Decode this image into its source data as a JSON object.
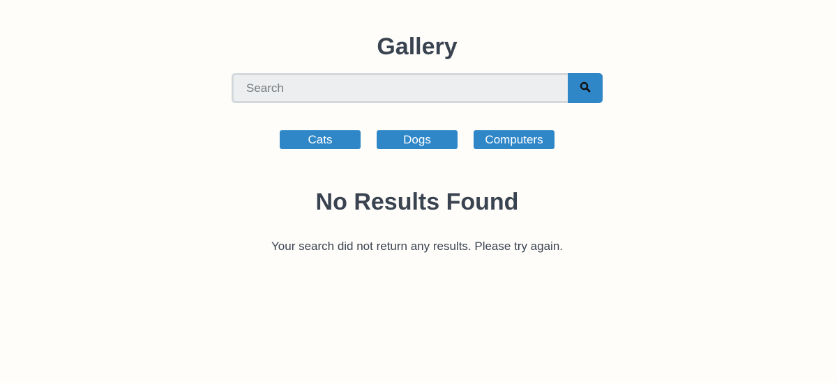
{
  "header": {
    "title": "Gallery"
  },
  "search": {
    "placeholder": "Search",
    "value": "",
    "button_icon": "search-icon"
  },
  "categories": [
    {
      "label": "Cats"
    },
    {
      "label": "Dogs"
    },
    {
      "label": "Computers"
    }
  ],
  "results": {
    "title": "No Results Found",
    "message": "Your search did not return any results. Please try again."
  },
  "colors": {
    "accent": "#2f87c8",
    "text": "#3a4350",
    "background": "#fefdfa",
    "input_bg": "#eceeef"
  }
}
